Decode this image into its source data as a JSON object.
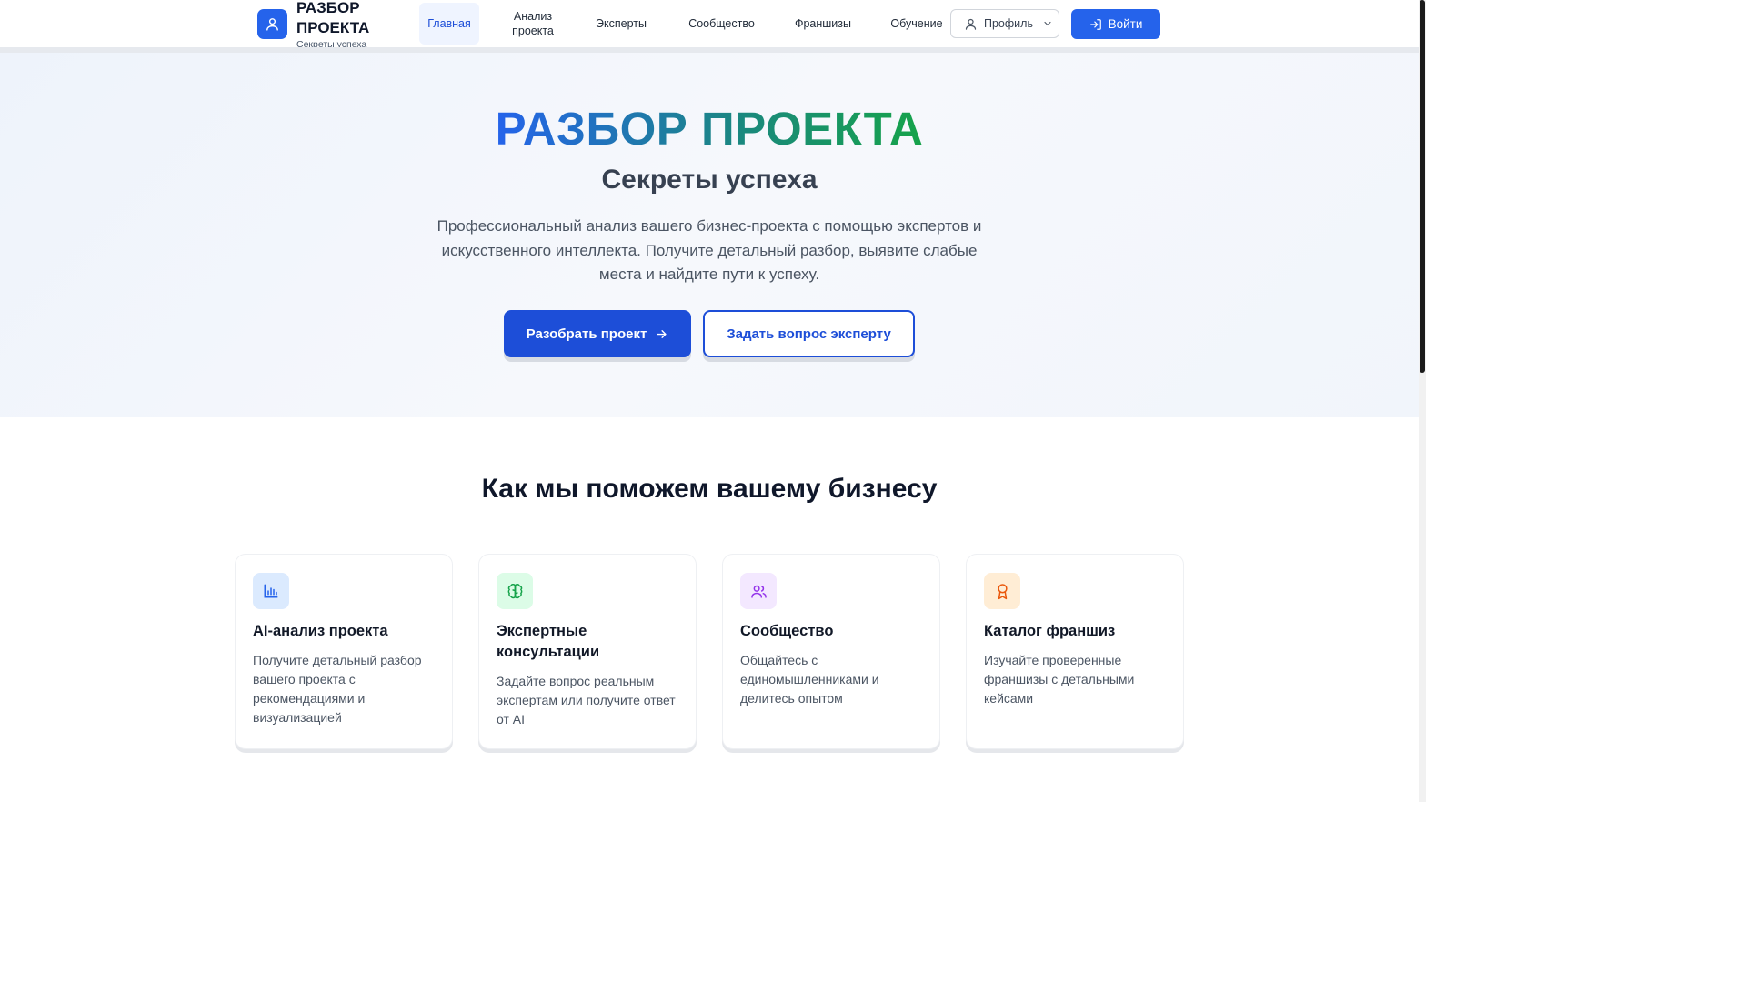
{
  "header": {
    "logo_title": "РАЗБОР ПРОЕКТА",
    "logo_subtitle": "Секреты успеха",
    "logo_icon": "user-icon",
    "nav": [
      {
        "label": "Главная",
        "active": true
      },
      {
        "label": "Анализ проекта",
        "active": false
      },
      {
        "label": "Эксперты",
        "active": false
      },
      {
        "label": "Сообщество",
        "active": false
      },
      {
        "label": "Франшизы",
        "active": false
      },
      {
        "label": "Обучение",
        "active": false
      }
    ],
    "profile_label": "Профиль",
    "login_label": "Войти"
  },
  "hero": {
    "title": "РАЗБОР ПРОЕКТА",
    "subtitle": "Секреты успеха",
    "description": "Профессиональный анализ вашего бизнес-проекта с помощью экспертов и искусственного интеллекта. Получите детальный разбор, выявите слабые места и найдите пути к успеху.",
    "primary_button": "Разобрать проект",
    "secondary_button": "Задать вопрос эксперту"
  },
  "features": {
    "title": "Как мы поможем вашему бизнесу",
    "cards": [
      {
        "title": "AI-анализ проекта",
        "description": "Получите детальный разбор вашего проекта с рекомендациями и визуализацией",
        "icon": "bar-chart-icon",
        "color": "#2563eb",
        "bg": "#dbeafe"
      },
      {
        "title": "Экспертные консультации",
        "description": "Задайте вопрос реальным экспертам или получите ответ от AI",
        "icon": "brain-icon",
        "color": "#16a34a",
        "bg": "#dcfce7"
      },
      {
        "title": "Сообщество",
        "description": "Общайтесь с единомышленниками и делитесь опытом",
        "icon": "users-icon",
        "color": "#9333ea",
        "bg": "#f3e8ff"
      },
      {
        "title": "Каталог франшиз",
        "description": "Изучайте проверенные франшизы с детальными кейсами",
        "icon": "award-icon",
        "color": "#ea580c",
        "bg": "#ffedd5"
      }
    ]
  },
  "colors": {
    "accent": "#2563eb",
    "gradient_end": "#16a34a"
  }
}
